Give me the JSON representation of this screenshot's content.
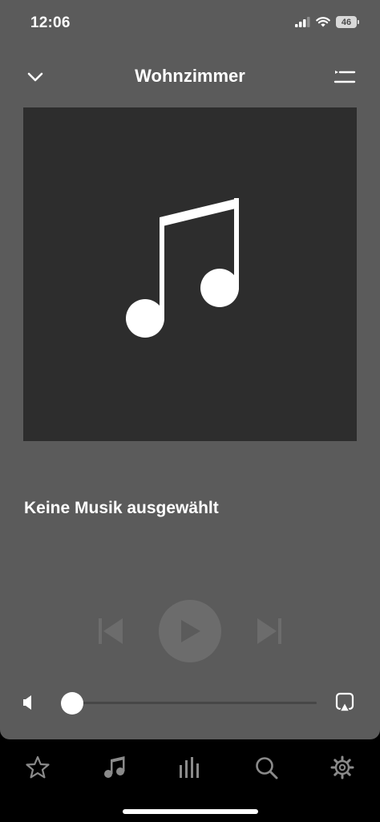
{
  "status_bar": {
    "time": "12:06",
    "battery": "46",
    "icons": [
      "signal-icon",
      "wifi-icon",
      "battery-icon"
    ]
  },
  "header": {
    "title": "Wohnzimmer",
    "left_icon": "chevron-down-icon",
    "right_icon": "queue-list-icon"
  },
  "artwork": {
    "icon": "music-note-icon"
  },
  "track": {
    "title": "Keine Musik ausgewählt"
  },
  "transport": {
    "prev_icon": "skip-previous-icon",
    "play_icon": "play-icon",
    "next_icon": "skip-next-icon",
    "enabled": false
  },
  "volume": {
    "level": 0.0,
    "icon": "speaker-icon",
    "output_icon": "airplay-icon"
  },
  "tabs": [
    {
      "name": "favorites",
      "icon": "star-icon"
    },
    {
      "name": "music",
      "icon": "music-note-icon"
    },
    {
      "name": "rooms",
      "icon": "equalizer-icon"
    },
    {
      "name": "search",
      "icon": "search-icon"
    },
    {
      "name": "settings",
      "icon": "gear-icon"
    }
  ],
  "colors": {
    "sheet_bg": "#5b5b5b",
    "artwork_bg": "#2d2d2d",
    "disabled_control": "#6c6c6c",
    "tab_icon": "#8a8a8a",
    "background": "#000000"
  }
}
